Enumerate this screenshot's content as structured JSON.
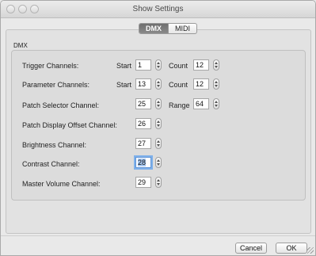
{
  "window": {
    "title": "Show Settings"
  },
  "tabs": [
    {
      "label": "DMX",
      "active": true
    },
    {
      "label": "MIDI",
      "active": false
    }
  ],
  "group": {
    "title": "DMX"
  },
  "rows": {
    "trigger": {
      "label": "Trigger Channels:",
      "start_label": "Start",
      "start_value": "1",
      "count_label": "Count",
      "count_value": "12"
    },
    "parameter": {
      "label": "Parameter Channels:",
      "start_label": "Start",
      "start_value": "13",
      "count_label": "Count",
      "count_value": "12"
    },
    "patch_selector": {
      "label": "Patch Selector Channel:",
      "value": "25",
      "range_label": "Range",
      "range_value": "64"
    },
    "patch_display_offset": {
      "label": "Patch Display Offset Channel:",
      "value": "26"
    },
    "brightness": {
      "label": "Brightness Channel:",
      "value": "27"
    },
    "contrast": {
      "label": "Contrast Channel:",
      "value": "28"
    },
    "master_volume": {
      "label": "Master Volume Channel:",
      "value": "29"
    }
  },
  "buttons": {
    "cancel": "Cancel",
    "ok": "OK"
  }
}
